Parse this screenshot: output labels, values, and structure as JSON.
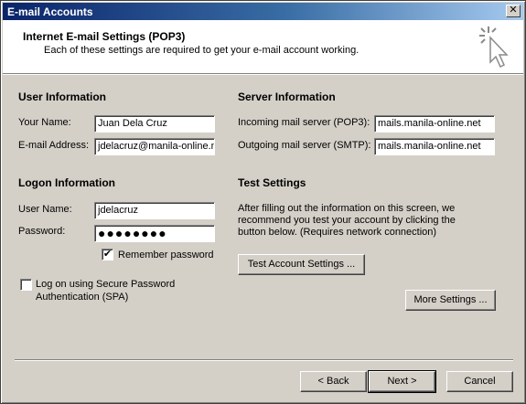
{
  "window": {
    "title": "E-mail Accounts",
    "close_glyph": "✕"
  },
  "header": {
    "title": "Internet E-mail Settings (POP3)",
    "subtitle": "Each of these settings are required to get your e-mail account working.",
    "icon": "cursor-sparkle-icon"
  },
  "user_info": {
    "heading": "User Information",
    "name_label": "Your Name:",
    "name_value": "Juan Dela Cruz",
    "email_label": "E-mail Address:",
    "email_value": "jdelacruz@manila-online.n"
  },
  "logon_info": {
    "heading": "Logon Information",
    "username_label": "User Name:",
    "username_value": "jdelacruz",
    "password_label": "Password:",
    "password_value": "●●●●●●●●",
    "remember_label": "Remember password",
    "remember_checked": "✔",
    "spa_label_line1": "Log on using Secure Password",
    "spa_label_line2": "Authentication (SPA)"
  },
  "server_info": {
    "heading": "Server Information",
    "incoming_label": "Incoming mail server (POP3):",
    "incoming_value": "mails.manila-online.net",
    "outgoing_label": "Outgoing mail server (SMTP):",
    "outgoing_value": "mails.manila-online.net"
  },
  "test_settings": {
    "heading": "Test Settings",
    "desc_line1": "After filling out the information on this screen, we",
    "desc_line2": "recommend you test your account by clicking the",
    "desc_line3": "button below. (Requires network connection)",
    "test_button": "Test Account Settings ..."
  },
  "more_settings_button": "More Settings ...",
  "footer": {
    "back": "< Back",
    "next": "Next >",
    "cancel": "Cancel"
  }
}
